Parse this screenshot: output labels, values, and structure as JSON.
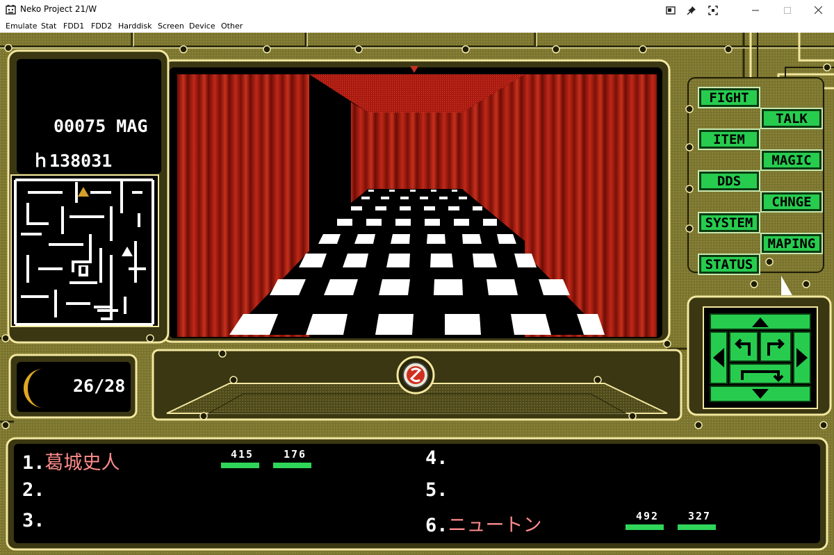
{
  "window": {
    "title": "Neko Project 21/W"
  },
  "menu": [
    "Emulate",
    "Stat",
    "FDD1",
    "FDD2",
    "Harddisk",
    "Screen",
    "Device",
    "Other"
  ],
  "status": {
    "mag_line": "00075 MAG",
    "money_line": "ｈ138031"
  },
  "moon": {
    "phase": "26/28"
  },
  "commands": {
    "fight": "FIGHT",
    "talk": "TALK",
    "item": "ITEM",
    "magic": "MAGIC",
    "dds": "DDS",
    "change": "CHNGE",
    "system": "SYSTEM",
    "maping": "MAPING",
    "status": "STATUS"
  },
  "party": [
    {
      "slot": "1.",
      "name": "葛城史人",
      "hp": "415",
      "mp": "176"
    },
    {
      "slot": "2.",
      "name": "",
      "hp": "",
      "mp": ""
    },
    {
      "slot": "3.",
      "name": "",
      "hp": "",
      "mp": ""
    },
    {
      "slot": "4.",
      "name": "",
      "hp": "",
      "mp": ""
    },
    {
      "slot": "5.",
      "name": "",
      "hp": "",
      "mp": ""
    },
    {
      "slot": "6.",
      "name": "ニュートン",
      "hp": "492",
      "mp": "327"
    }
  ],
  "colors": {
    "panel_olive": "#6e6a2a",
    "accent_green": "#27cc4f",
    "curtain_red": "#b01e12",
    "name_pink": "#ff8c8c"
  },
  "icons": [
    "neko-app-icon",
    "window-mode-icon",
    "pin-icon",
    "capture-icon",
    "minimize-icon",
    "maximize-icon",
    "close-icon",
    "compass-s-icon",
    "moon-icon"
  ]
}
